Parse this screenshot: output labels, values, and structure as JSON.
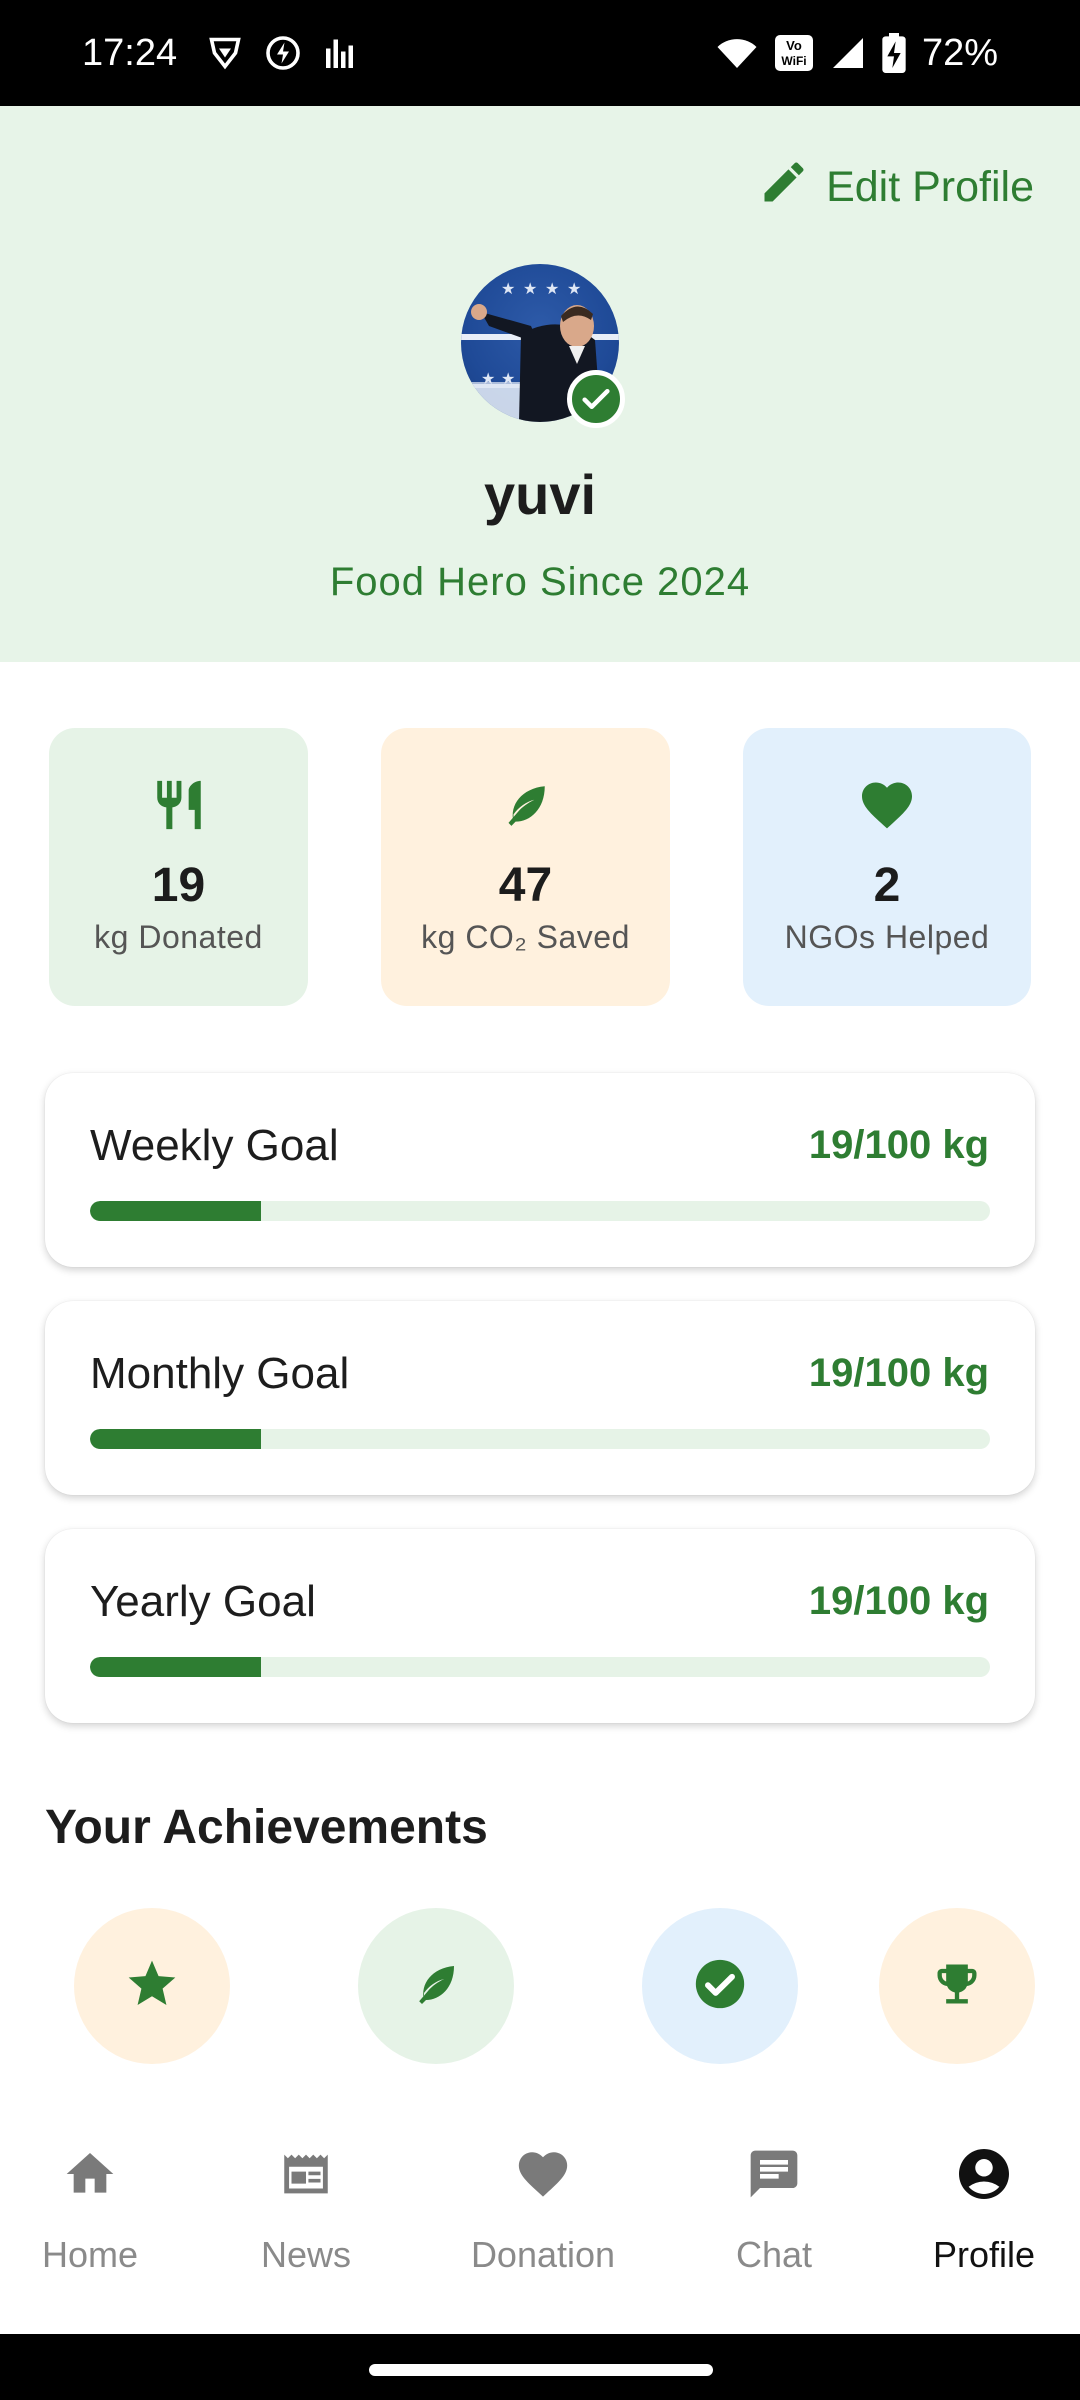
{
  "status_bar": {
    "time": "17:24",
    "battery": "72%",
    "network_label": "VoWiFi"
  },
  "header": {
    "edit_profile_label": "Edit Profile",
    "username": "yuvi",
    "since": "Food Hero Since 2024"
  },
  "stats": [
    {
      "value": "19",
      "label": "kg Donated",
      "icon": "cutlery-icon"
    },
    {
      "value": "47",
      "label": "kg CO₂ Saved",
      "icon": "leaf-icon"
    },
    {
      "value": "2",
      "label": "NGOs Helped",
      "icon": "heart-icon"
    }
  ],
  "goals": [
    {
      "title": "Weekly Goal",
      "value": "19/100 kg",
      "progress": 0.19
    },
    {
      "title": "Monthly Goal",
      "value": "19/100 kg",
      "progress": 0.19
    },
    {
      "title": "Yearly Goal",
      "value": "19/100 kg",
      "progress": 0.19
    }
  ],
  "achievements": {
    "title": "Your Achievements",
    "badges": [
      "star-icon",
      "leaf-icon",
      "check-circle-icon",
      "trophy-icon"
    ]
  },
  "nav": [
    {
      "label": "Home",
      "icon": "home-icon"
    },
    {
      "label": "News",
      "icon": "newspaper-icon"
    },
    {
      "label": "Donation",
      "icon": "heart-icon"
    },
    {
      "label": "Chat",
      "icon": "chat-icon"
    },
    {
      "label": "Profile",
      "icon": "account-circle-icon",
      "active": true
    }
  ],
  "colors": {
    "accent": "#2e7d32",
    "header_bg": "#e7f4e8",
    "green_tint": "#e6f3e7",
    "orange_tint": "#fff1de",
    "blue_tint": "#e2f0fc"
  }
}
